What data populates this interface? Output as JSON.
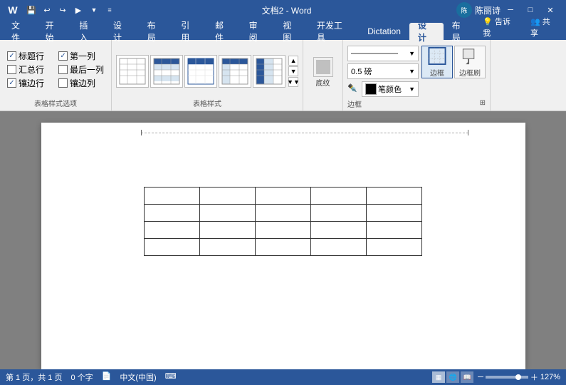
{
  "titleBar": {
    "title": "文档2 - Word",
    "userIcon": "陈丽诗",
    "winBtns": [
      "─",
      "□",
      "✕"
    ]
  },
  "quickAccess": [
    "💾",
    "↩",
    "↪",
    "▸",
    "≡"
  ],
  "ribbonTabs": [
    {
      "label": "文件",
      "active": false
    },
    {
      "label": "开始",
      "active": false
    },
    {
      "label": "插入",
      "active": false
    },
    {
      "label": "设计",
      "active": false
    },
    {
      "label": "布局",
      "active": false
    },
    {
      "label": "引用",
      "active": false
    },
    {
      "label": "邮件",
      "active": false
    },
    {
      "label": "审阅",
      "active": false
    },
    {
      "label": "视图",
      "active": false
    },
    {
      "label": "开发工具",
      "active": false
    },
    {
      "label": "Dictation",
      "active": false
    },
    {
      "label": "设计",
      "active": true
    },
    {
      "label": "布局",
      "active": false
    }
  ],
  "ribbonRightBtns": [
    {
      "label": "告诉我",
      "icon": "💡"
    },
    {
      "label": "共享",
      "icon": "👥"
    }
  ],
  "tableStyleOptions": {
    "groupLabel": "表格样式选项",
    "checkboxes": [
      {
        "label": "标题行",
        "checked": true
      },
      {
        "label": "第一列",
        "checked": true
      },
      {
        "label": "汇总行",
        "checked": false
      },
      {
        "label": "最后一列",
        "checked": false
      },
      {
        "label": "镶边行",
        "checked": true
      },
      {
        "label": "镶边列",
        "checked": false
      }
    ]
  },
  "tableStyles": {
    "groupLabel": "表格样式"
  },
  "shadingGroup": {
    "label": "底纹",
    "btnLabel": "底纹"
  },
  "borderGroup": {
    "groupLabel": "边框",
    "styleLabel": "边框样式",
    "thicknessLabel": "0.5 磅",
    "colorLabel": "笔颜色",
    "borderBtnLabel": "边框",
    "brushBtnLabel": "边框刷",
    "expandIcon": "⊞"
  },
  "statusBar": {
    "page": "第 1 页，共 1 页",
    "words": "0 个字",
    "lang": "中文(中国)",
    "docIcon": "📄",
    "zoom": "127%"
  }
}
